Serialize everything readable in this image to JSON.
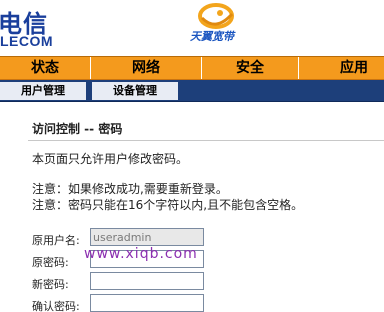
{
  "header": {
    "brand_cn": "电信",
    "brand_en": "LECOM",
    "logo_text": "天翼宽带"
  },
  "nav": {
    "items": [
      {
        "label": "状态"
      },
      {
        "label": "网络"
      },
      {
        "label": "安全"
      },
      {
        "label": "应用"
      }
    ]
  },
  "subnav": {
    "items": [
      {
        "label": "用户管理"
      },
      {
        "label": "设备管理"
      }
    ]
  },
  "main": {
    "title": "访问控制 -- 密码",
    "description": "本页面只允许用户修改密码。",
    "note1": "注意：如果修改成功,需要重新登录。",
    "note2": "注意：密码只能在16个字符以内,且不能包含空格。",
    "form": {
      "username_label": "原用户名:",
      "username_value": "useradmin",
      "old_password_label": "原密码:",
      "new_password_label": "新密码:",
      "confirm_password_label": "确认密码:"
    }
  },
  "watermark": "www.xiqb.com",
  "colors": {
    "nav_bg": "#f49a1d",
    "subnav_bg": "#1d3f7a",
    "brand": "#1a3f9c"
  }
}
